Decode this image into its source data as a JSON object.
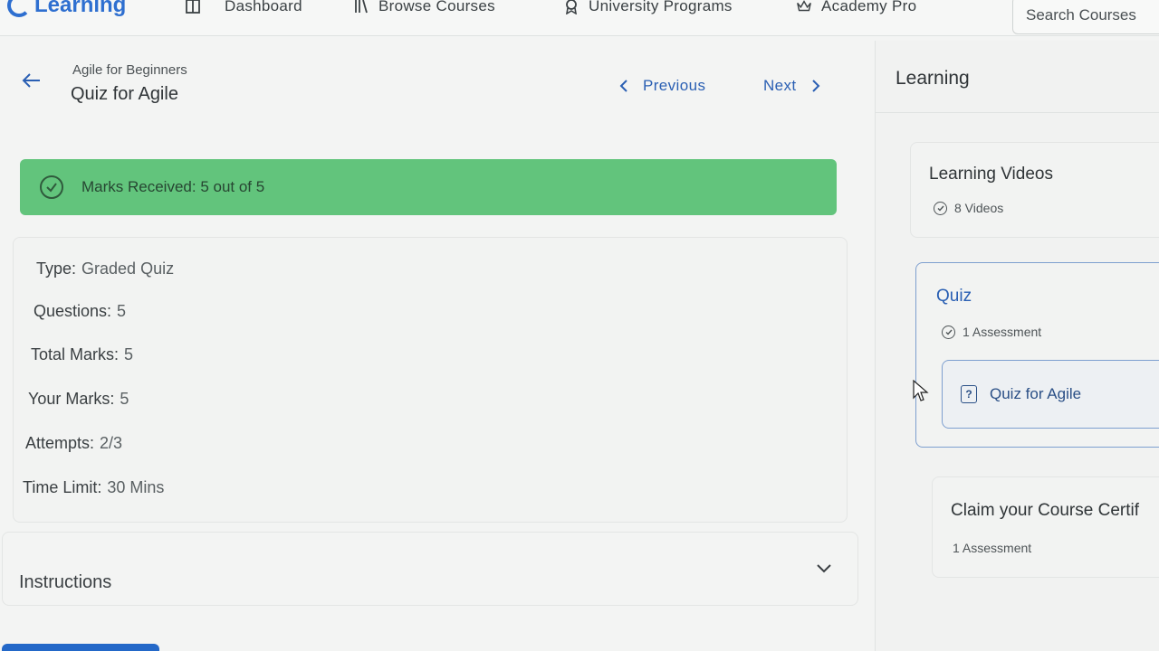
{
  "nav": {
    "logo_text": "Learning",
    "items": [
      {
        "label": "Dashboard",
        "icon": "dashboard-icon"
      },
      {
        "label": "Browse Courses",
        "icon": "library-icon"
      },
      {
        "label": "University Programs",
        "icon": "award-icon"
      },
      {
        "label": "Academy Pro",
        "icon": "crown-icon"
      }
    ],
    "search_placeholder": "Search Courses"
  },
  "header": {
    "breadcrumb": "Agile for Beginners",
    "title": "Quiz for Agile",
    "previous_label": "Previous",
    "next_label": "Next"
  },
  "banner": {
    "text": "Marks Received: 5 out of 5",
    "color": "#62c47c"
  },
  "details": {
    "type_label": "Type:",
    "type_value": "Graded Quiz",
    "questions_label": "Questions:",
    "questions_value": "5",
    "total_marks_label": "Total Marks:",
    "total_marks_value": "5",
    "your_marks_label": "Your Marks:",
    "your_marks_value": "5",
    "attempts_label": "Attempts:",
    "attempts_value": "2/3",
    "time_limit_label": "Time Limit:",
    "time_limit_value": "30 Mins"
  },
  "instructions": {
    "label": "Instructions"
  },
  "sidebar": {
    "title": "Learning",
    "sections": [
      {
        "title": "Learning Videos",
        "meta": "8 Videos"
      },
      {
        "title": "Quiz",
        "meta": "1 Assessment",
        "items": [
          {
            "label": "Quiz for Agile"
          }
        ]
      },
      {
        "title": "Claim your Course Certif",
        "meta": "1 Assessment"
      }
    ]
  },
  "colors": {
    "accent": "#2a5fb3",
    "success": "#62c47c"
  }
}
